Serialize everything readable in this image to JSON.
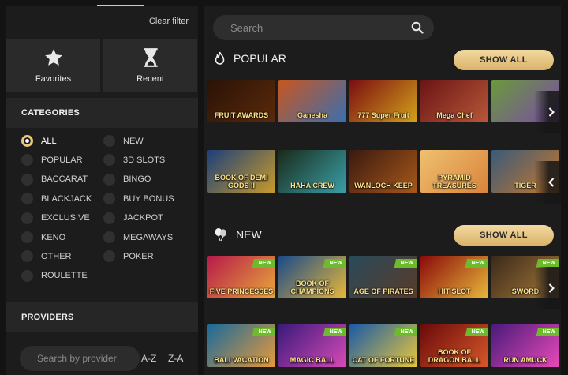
{
  "sidebar": {
    "clear_filter": "Clear filter",
    "favorites_label": "Favorites",
    "recent_label": "Recent",
    "categories_title": "CATEGORIES",
    "categories": [
      {
        "label": "ALL",
        "selected": true
      },
      {
        "label": "NEW",
        "selected": false
      },
      {
        "label": "POPULAR",
        "selected": false
      },
      {
        "label": "3D SLOTS",
        "selected": false
      },
      {
        "label": "BACCARAT",
        "selected": false
      },
      {
        "label": "BINGO",
        "selected": false
      },
      {
        "label": "BLACKJACK",
        "selected": false
      },
      {
        "label": "BUY BONUS",
        "selected": false
      },
      {
        "label": "EXCLUSIVE",
        "selected": false
      },
      {
        "label": "JACKPOT",
        "selected": false
      },
      {
        "label": "KENO",
        "selected": false
      },
      {
        "label": "MEGAWAYS",
        "selected": false
      },
      {
        "label": "OTHER",
        "selected": false
      },
      {
        "label": "POKER",
        "selected": false
      },
      {
        "label": "ROULETTE",
        "selected": false
      }
    ],
    "providers_title": "PROVIDERS",
    "provider_search_placeholder": "Search by provider",
    "sort_az": "A-Z",
    "sort_za": "Z-A"
  },
  "main": {
    "search_placeholder": "Search",
    "popular": {
      "title": "POPULAR",
      "show_all": "SHOW ALL",
      "row1": [
        {
          "name": "FRUIT AWARDS",
          "colors": [
            "#2a1206",
            "#5a2a0c"
          ]
        },
        {
          "name": "Ganesha",
          "colors": [
            "#c8561e",
            "#3a6fb0"
          ]
        },
        {
          "name": "777 Super Fruit",
          "colors": [
            "#7a0d12",
            "#d4a21a"
          ]
        },
        {
          "name": "Mega Chef",
          "colors": [
            "#6a1414",
            "#b8583a"
          ]
        },
        {
          "name": "",
          "colors": [
            "#6a9a3a",
            "#7a4aa8"
          ]
        }
      ],
      "row2": [
        {
          "name": "BOOK OF DEMI GODS II",
          "colors": [
            "#1e3f7a",
            "#c89b2a"
          ]
        },
        {
          "name": "HAHA CREW",
          "colors": [
            "#1a2a1a",
            "#3aa0a8"
          ]
        },
        {
          "name": "WANLOCH KEEP",
          "colors": [
            "#3a1a10",
            "#a8581a"
          ]
        },
        {
          "name": "PYRAMID TREASURES",
          "colors": [
            "#f0c070",
            "#d8843a"
          ]
        },
        {
          "name": "TIGER",
          "colors": [
            "#3a5a7a",
            "#c8782a"
          ]
        }
      ]
    },
    "new": {
      "title": "NEW",
      "show_all": "SHOW ALL",
      "badge": "NEW",
      "row1": [
        {
          "name": "FIVE PRINCESSES",
          "colors": [
            "#b81a4a",
            "#e8a83a"
          ]
        },
        {
          "name": "BOOK OF CHAMPIONS",
          "colors": [
            "#1a4a8a",
            "#e8b83a"
          ]
        },
        {
          "name": "AGE OF PIRATES",
          "colors": [
            "#2a4a5a",
            "#5a3a2a"
          ]
        },
        {
          "name": "HIT SLOT",
          "colors": [
            "#8a0a0a",
            "#e8b83a"
          ]
        },
        {
          "name": "SWORD",
          "colors": [
            "#3a2a1a",
            "#a87a3a"
          ]
        }
      ],
      "row2": [
        {
          "name": "BALI VACATION",
          "colors": [
            "#1a6a9a",
            "#e89a3a"
          ]
        },
        {
          "name": "MAGIC BALL",
          "colors": [
            "#3a1a7a",
            "#d84ab8"
          ]
        },
        {
          "name": "CAT OF FORTUNE",
          "colors": [
            "#1a5aa8",
            "#e8c83a"
          ]
        },
        {
          "name": "BOOK OF DRAGON BALL",
          "colors": [
            "#6a0a0a",
            "#d8582a"
          ]
        },
        {
          "name": "RUN AMUCK",
          "colors": [
            "#4a1a7a",
            "#e84ab8"
          ]
        }
      ]
    }
  }
}
